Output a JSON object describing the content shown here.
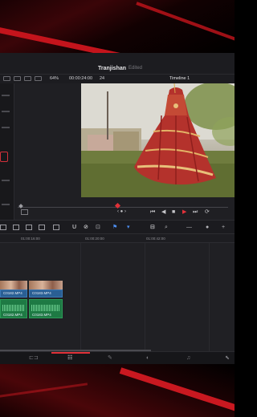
{
  "project": {
    "name": "Tranjishan",
    "status": "Edited"
  },
  "viewer_bar": {
    "zoom": "64%",
    "timecode": "00:00:24:00",
    "fps": "24",
    "timeline_name": "Timeline 1"
  },
  "ruler": {
    "ticks": [
      "01:00:16:00",
      "01:00:20:00",
      "01:00:42:00"
    ]
  },
  "clips": [
    {
      "name": "C0182.MP4",
      "audio_name": "C0182.MP4"
    },
    {
      "name": "C0183.MP4",
      "audio_name": "C0183.MP4"
    }
  ],
  "colors": {
    "accent_red": "#e03138",
    "video_clip": "#2a5f94",
    "audio_clip": "#1e7a44",
    "tool_blue": "#4d8ff2"
  },
  "icons": {
    "transport": [
      "skip-start-icon",
      "step-back-icon",
      "stop-icon",
      "play-icon",
      "skip-end-icon",
      "loop-icon"
    ],
    "toolbar": [
      "clip-icon",
      "track-icon",
      "select-icon",
      "trim-icon",
      "blade-icon",
      "link-icon",
      "lock-icon",
      "flag-icon",
      "marker-icon",
      "zoom-icon"
    ],
    "pages": [
      "media-page-icon",
      "edit-page-icon",
      "fusion-page-icon",
      "color-page-icon",
      "fairlight-page-icon",
      "deliver-page-icon"
    ]
  }
}
